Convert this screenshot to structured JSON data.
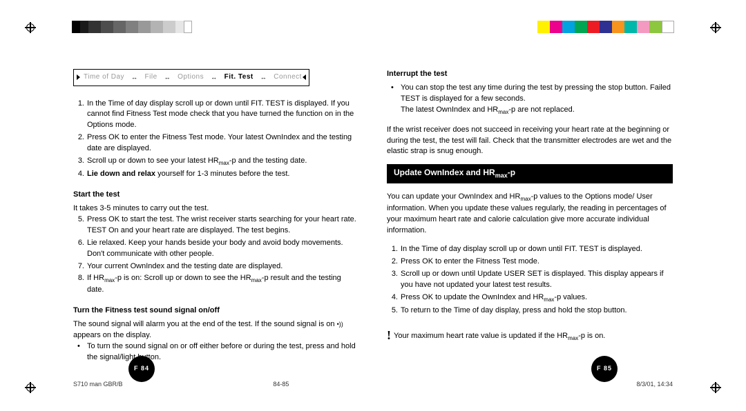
{
  "colorbar_left": [
    "#000",
    "#1a1a1a",
    "#333",
    "#4d4d4d",
    "#666",
    "#808080",
    "#999",
    "#b3b3b3",
    "#ccc",
    "#e6e6e6",
    "#fff"
  ],
  "colorbar_right": [
    "#fff100",
    "#ec008c",
    "#00a2e0",
    "#00a651",
    "#ed1c24",
    "#2e3192",
    "#f7941d",
    "#00b8a9",
    "#f49ac1",
    "#8dc63f",
    "#fff"
  ],
  "nav": {
    "items": [
      "Time of Day",
      "File",
      "Options",
      "Fit. Test",
      "Connect"
    ],
    "active_index": 3
  },
  "left": {
    "intro_list": [
      "In the Time of day display scroll up or down until FIT. TEST is displayed. If you cannot find Fitness Test mode check that you have turned the function on in the Options mode.",
      "Press OK to enter the Fitness Test mode. Your latest OwnIndex and the testing date are displayed.",
      "Scroll up or down to see your latest HR<sub>max</sub>-p and the testing date.",
      "<b>Lie down and relax</b> yourself for 1-3 minutes before the test."
    ],
    "start_h": "Start the test",
    "start_intro": "It takes 3-5 minutes to carry out the test.",
    "start_list": [
      "Press OK to start the test. The wrist receiver starts searching for your heart rate. TEST On and your heart rate are displayed. The test begins.",
      "Lie relaxed. Keep your hands beside your body and avoid body movements. Don't communicate with other people.",
      "Your current OwnIndex and the testing date are displayed.",
      "If HR<sub>max</sub>-p is on: Scroll up or down to see the HR<sub>max</sub>-p result and the testing date."
    ],
    "sound_h": "Turn the Fitness test sound signal on/off",
    "sound_intro_a": "The sound signal will alarm you at the end of the test. If the sound signal is on ",
    "sound_intro_b": " appears on the display.",
    "sound_bullets": [
      "To turn the sound signal on or off either before or during the test, press and hold the signal/light button."
    ]
  },
  "right": {
    "interrupt_h": "Interrupt the test",
    "interrupt_bullets": [
      "You can stop the test any time during the test by pressing the stop button. Failed TEST is displayed for a few seconds.<br>The latest OwnIndex and HR<sub>max</sub>-p are not replaced."
    ],
    "interrupt_note": "If the wrist receiver does not succeed in receiving your heart rate at the beginning or during the test, the test will fail. Check that the transmitter electrodes are wet and the elastic strap is snug enough.",
    "update_bar": "Update OwnIndex and HR<sub>max</sub>-p",
    "update_intro": "You can update your OwnIndex and HR<sub>max</sub>-p values to the Options mode/ User information. When you update these values regularly, the reading in percentages of your maximum heart rate and calorie calculation give more accurate individual information.",
    "update_list": [
      "In the Time of day display scroll up or down until FIT. TEST is displayed.",
      "Press OK to enter the Fitness Test mode.",
      "Scroll up or down until Update USER SET is displayed. This display appears if you have not updated your latest test results.",
      "Press OK to update the OwnIndex and HR<sub>max</sub>-p values.",
      "To return to the Time of day display, press and hold the stop button."
    ],
    "warn": "Your maximum heart rate value is updated if the HR<sub>max</sub>-p is on."
  },
  "page_left": "F 84",
  "page_right": "F 85",
  "footer": {
    "doc": "S710 man GBR/B",
    "pages": "84-85",
    "date": "8/3/01, 14:34"
  }
}
